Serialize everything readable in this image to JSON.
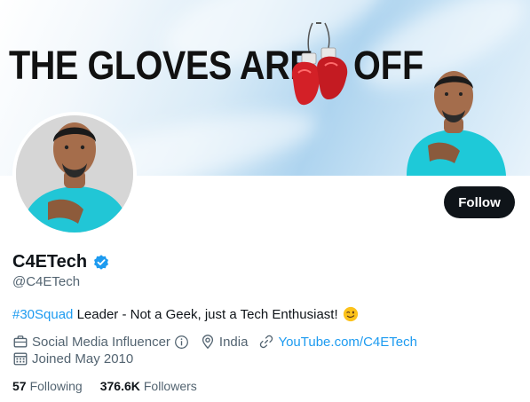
{
  "banner": {
    "title": "THE GLOVES ARE",
    "title_end": "OFF"
  },
  "profile": {
    "display_name": "C4ETech",
    "handle": "@C4ETech",
    "follow_label": "Follow",
    "bio_hashtag": "#30Squad",
    "bio_text": " Leader - Not a Geek, just a Tech Enthusiast!",
    "category": "Social Media Influencer",
    "location": "India",
    "website": "YouTube.com/C4ETech",
    "joined": "Joined May 2010",
    "following_count": "57",
    "following_label": "Following",
    "followers_count": "376.6K",
    "followers_label": "Followers"
  },
  "colors": {
    "accent": "#1d9bf0",
    "verified": "#1d9bf0",
    "button_bg": "#0f1419",
    "secondary_text": "#536471"
  },
  "icons": [
    "verified-badge-icon",
    "briefcase-icon",
    "info-icon",
    "location-pin-icon",
    "link-icon",
    "calendar-icon",
    "winking-emoji-icon"
  ]
}
